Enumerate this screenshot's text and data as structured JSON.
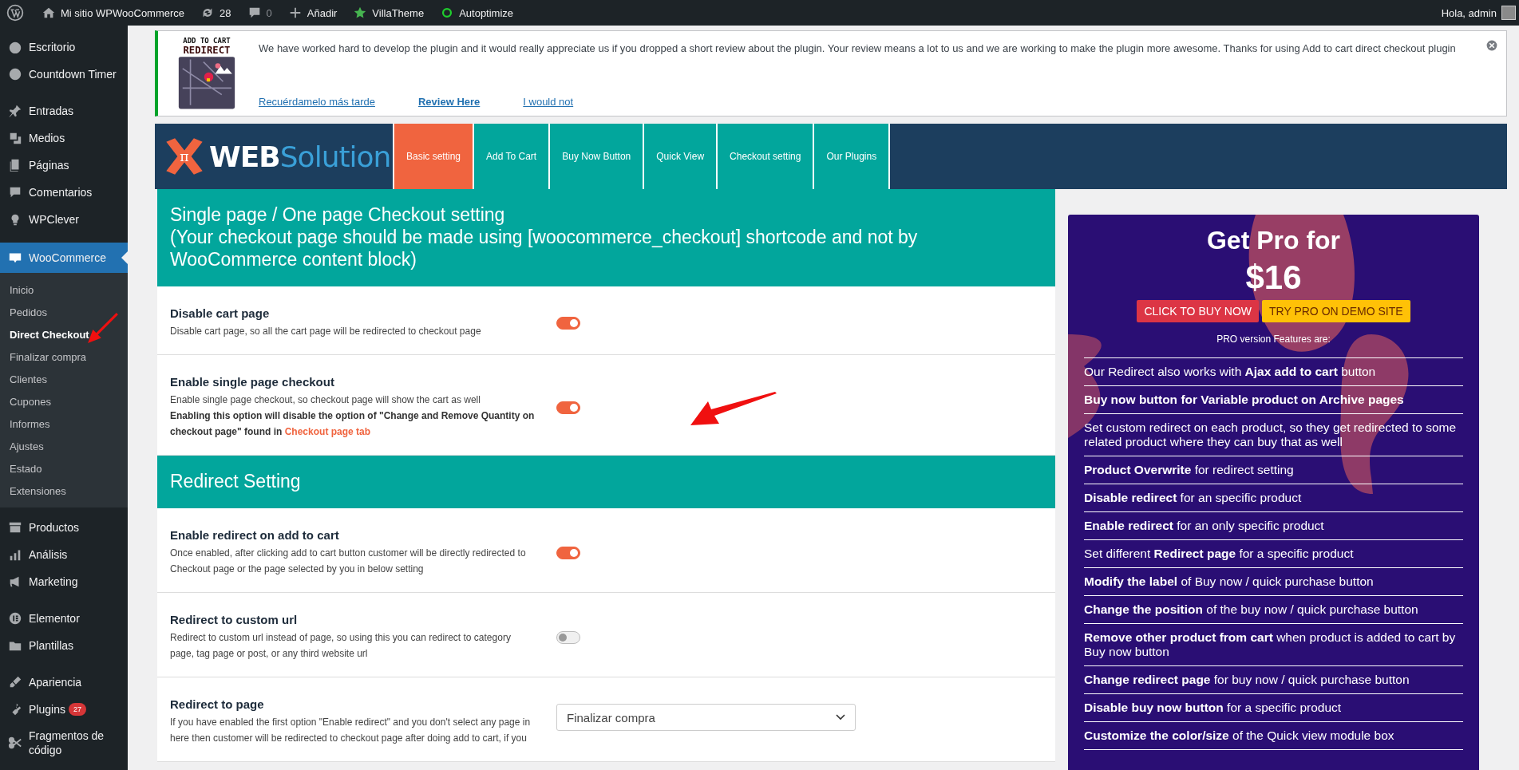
{
  "admin_bar": {
    "site_name": "Mi sitio WPWooCommerce",
    "updates": "28",
    "comments": "0",
    "add": "Añadir",
    "items": [
      "VillaTheme",
      "Autoptimize"
    ],
    "greeting": "Hola, admin"
  },
  "sidebar": {
    "groups": [
      [
        {
          "label": "Escritorio",
          "selected": false
        },
        {
          "label": "Countdown Timer",
          "selected": false
        }
      ],
      [
        {
          "label": "Entradas",
          "selected": false
        },
        {
          "label": "Medios",
          "selected": false
        },
        {
          "label": "Páginas",
          "selected": false
        },
        {
          "label": "Comentarios",
          "selected": false
        },
        {
          "label": "WPClever",
          "selected": false
        }
      ],
      [
        {
          "label": "WooCommerce",
          "selected": true,
          "children": [
            {
              "label": "Inicio",
              "selected": false
            },
            {
              "label": "Pedidos",
              "selected": false
            },
            {
              "label": "Direct Checkout",
              "selected": true
            },
            {
              "label": "Finalizar compra",
              "selected": false
            },
            {
              "label": "Clientes",
              "selected": false
            },
            {
              "label": "Cupones",
              "selected": false
            },
            {
              "label": "Informes",
              "selected": false
            },
            {
              "label": "Ajustes",
              "selected": false
            },
            {
              "label": "Estado",
              "selected": false
            },
            {
              "label": "Extensiones",
              "selected": false
            }
          ]
        },
        {
          "label": "Productos",
          "selected": false
        },
        {
          "label": "Análisis",
          "selected": false
        },
        {
          "label": "Marketing",
          "selected": false
        }
      ],
      [
        {
          "label": "Elementor",
          "selected": false
        },
        {
          "label": "Plantillas",
          "selected": false
        }
      ],
      [
        {
          "label": "Apariencia",
          "selected": false
        },
        {
          "label": "Plugins",
          "selected": false,
          "badge": "27"
        },
        {
          "label": "Fragmentos de código",
          "selected": false
        }
      ]
    ]
  },
  "notice": {
    "logo_text": [
      "ADD TO CART",
      "REDIRECT"
    ],
    "message": "We have worked hard to develop the plugin and it would really appreciate us if you dropped a short review about the plugin. Your review means a lot to us and we are working to make the plugin more awesome. Thanks for using Add to cart direct checkout plugin",
    "links": [
      {
        "label": "Recuérdamelo más tarde",
        "bold": false
      },
      {
        "label": "Review Here",
        "bold": true
      },
      {
        "label": "I would not",
        "bold": false
      }
    ]
  },
  "plugin_header": {
    "brand": {
      "symbol": "π",
      "first": "WEB",
      "second": "Solution"
    },
    "tabs": [
      {
        "label": "Basic setting",
        "selected": true
      },
      {
        "label": "Add To Cart",
        "selected": false
      },
      {
        "label": "Buy Now Button",
        "selected": false
      },
      {
        "label": "Quick View",
        "selected": false
      },
      {
        "label": "Checkout setting",
        "selected": false
      },
      {
        "label": "Our Plugins",
        "selected": false
      }
    ]
  },
  "sections": [
    {
      "title": [
        "Single page / One page Checkout setting",
        "(Your checkout page should be made using [woocommerce_checkout] shortcode and not by WooCommerce content block)"
      ],
      "rows": [
        {
          "kind": "toggle",
          "title": "Disable cart page",
          "description": "Disable cart page, so all the cart page will be redirected to checkout page",
          "on": true
        },
        {
          "kind": "toggle",
          "title": "Enable single page checkout",
          "description": "Enable single page checkout, so checkout page will show the cart as well",
          "note": "Enabling this option will disable the option of \"Change and Remove Quantity on checkout page\" found in",
          "note_link": "Checkout page tab",
          "on": true
        }
      ]
    },
    {
      "title": [
        "Redirect Setting"
      ],
      "rows": [
        {
          "kind": "toggle",
          "title": "Enable redirect on add to cart",
          "description": "Once enabled, after clicking add to cart button customer will be directly redirected to Checkout page or the page selected by you in below setting",
          "on": true
        },
        {
          "kind": "toggle",
          "title": "Redirect to custom url",
          "description": "Redirect to custom url instead of page, so using this you can redirect to category page, tag page or post, or any third website url",
          "on": false
        },
        {
          "kind": "select",
          "title": "Redirect to page",
          "description": "If you have enabled the first option \"Enable redirect\" and you don't select any page in here then customer will be redirected to checkout page after doing add to cart, if you",
          "value": "Finalizar compra"
        }
      ]
    }
  ],
  "pro": {
    "title": "Get Pro for",
    "price": "$16",
    "buttons": [
      {
        "label": "CLICK TO BUY NOW",
        "kind": "buy"
      },
      {
        "label": "TRY PRO ON DEMO SITE",
        "kind": "demo"
      }
    ],
    "subtitle": "PRO version Features are:",
    "features": [
      "Our Redirect also works with **Ajax add to cart** button",
      "**Buy now button for Variable product on Archive pages**",
      "Set custom redirect on each product, so they get redirected to some related product where they can buy that as well",
      "**Product Overwrite** for redirect setting",
      "**Disable redirect** for an specific product",
      "**Enable redirect** for an only specific product",
      "Set different **Redirect page** for a specific product",
      "**Modify the label** of Buy now / quick purchase button",
      "**Change the position** of the buy now / quick purchase button",
      "**Remove other product from cart** when product is added to cart by Buy now button",
      "**Change redirect page** for buy now / quick purchase button",
      "**Disable buy now button** for a specific product",
      "**Customize the color/size** of the Quick view module box"
    ]
  }
}
